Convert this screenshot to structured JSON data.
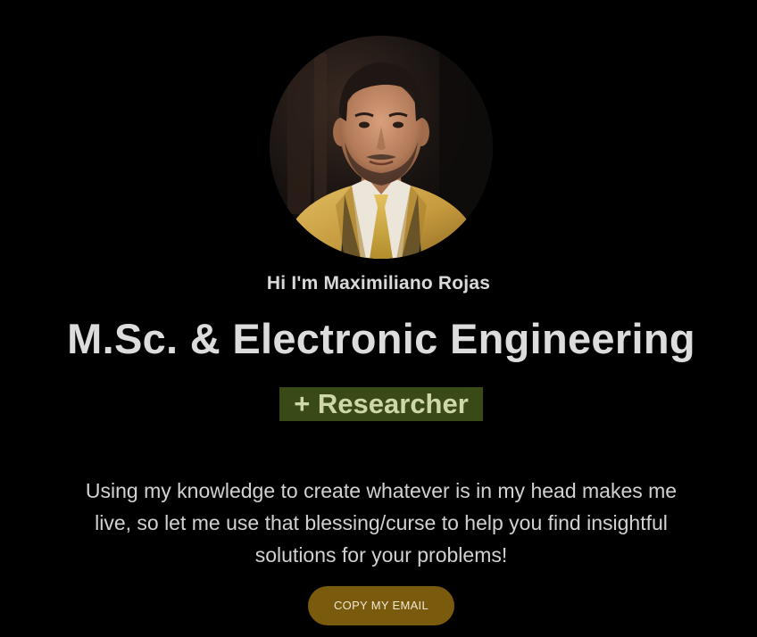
{
  "profile": {
    "photo_alt": "Portrait of Maximiliano Rojas",
    "greeting": "Hi I'm Maximiliano Rojas",
    "headline": "M.Sc. & Electronic Engineering",
    "tagline": "+ Researcher",
    "description": "Using my knowledge to create whatever is in my head makes me live, so let me use that blessing/curse to help you find insightful solutions for your problems!"
  },
  "actions": {
    "copy_email_label": "COPY MY EMAIL"
  },
  "colors": {
    "background": "#000000",
    "tag_background": "#3a4a16",
    "tag_text": "#cdd8a6",
    "button_background": "#7a5a0c",
    "text": "#d6d6d6"
  }
}
